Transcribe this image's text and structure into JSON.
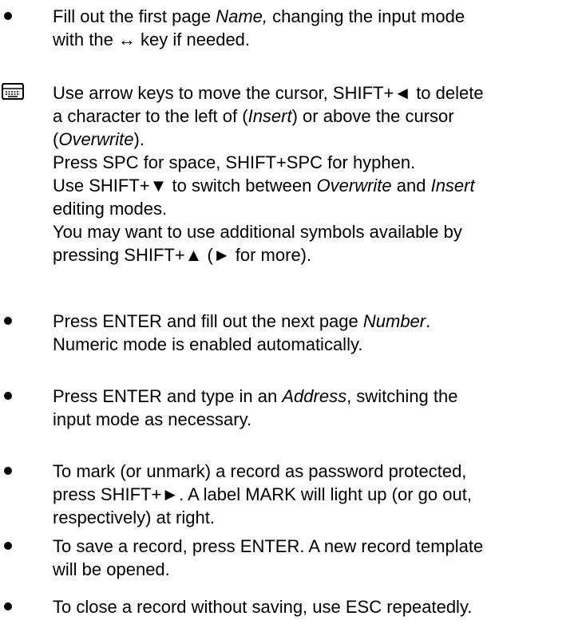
{
  "items": [
    {
      "type": "bullet",
      "icon": "bullet-dot",
      "lines": [
        [
          {
            "t": "Fill out the first page "
          },
          {
            "t": "Name,",
            "i": true
          },
          {
            "t": " changing the input mode"
          }
        ],
        [
          {
            "t": "with the ↔ key if needed."
          }
        ]
      ]
    },
    {
      "type": "note",
      "icon": "keyboard-icon",
      "lines": [
        [
          {
            "t": "Use arrow keys to move the cursor, SHIFT+◄ to delete"
          }
        ],
        [
          {
            "t": "a character to the left of ("
          },
          {
            "t": "Insert",
            "i": true
          },
          {
            "t": ") or above the cursor"
          }
        ],
        [
          {
            "t": "("
          },
          {
            "t": "Overwrite",
            "i": true
          },
          {
            "t": ")."
          }
        ],
        [
          {
            "t": "Press SPC for space, SHIFT+SPC for hyphen."
          }
        ],
        [
          {
            "t": "Use SHIFT+▼ to switch between "
          },
          {
            "t": "Overwrite",
            "i": true
          },
          {
            "t": " and "
          },
          {
            "t": "Insert",
            "i": true
          }
        ],
        [
          {
            "t": "editing modes."
          }
        ],
        [
          {
            "t": "You may want to use additional symbols available by"
          }
        ],
        [
          {
            "t": "pressing SHIFT+▲ (► for more)."
          }
        ]
      ]
    },
    {
      "type": "bullet",
      "icon": "bullet-dot",
      "lines": [
        [
          {
            "t": "Press ENTER and fill out the next page "
          },
          {
            "t": "Number",
            "i": true
          },
          {
            "t": "."
          }
        ],
        [
          {
            "t": "Numeric mode is enabled automatically."
          }
        ]
      ]
    },
    {
      "type": "bullet",
      "icon": "bullet-dot",
      "lines": [
        [
          {
            "t": "Press ENTER and type in an "
          },
          {
            "t": "Address",
            "i": true
          },
          {
            "t": ", switching the"
          }
        ],
        [
          {
            "t": "input mode as necessary."
          }
        ]
      ]
    },
    {
      "type": "bullet",
      "icon": "bullet-dot",
      "lines": [
        [
          {
            "t": "To mark (or unmark) a record as password protected,"
          }
        ],
        [
          {
            "t": "press SHIFT+►. A label MARK will light up (or go out,"
          }
        ],
        [
          {
            "t": "respectively) at right."
          }
        ]
      ]
    },
    {
      "type": "bullet",
      "icon": "bullet-dot",
      "lines": [
        [
          {
            "t": "To save a record, press ENTER. A new record template"
          }
        ],
        [
          {
            "t": "will be opened."
          }
        ]
      ]
    },
    {
      "type": "bullet",
      "icon": "bullet-dot",
      "lines": [
        [
          {
            "t": "To close a record without saving, use ESC repeatedly."
          }
        ]
      ]
    }
  ]
}
